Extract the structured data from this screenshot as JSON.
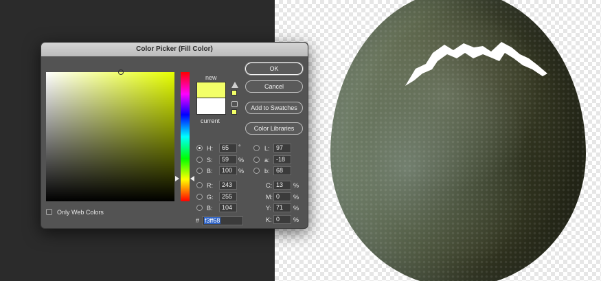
{
  "dialog": {
    "title": "Color Picker (Fill Color)",
    "new_label": "new",
    "current_label": "current",
    "new_color": "#f3ff68",
    "current_color": "#ffffff",
    "buttons": {
      "ok": "OK",
      "cancel": "Cancel",
      "add_to_swatches": "Add to Swatches",
      "color_libraries": "Color Libraries"
    },
    "only_web_colors": "Only Web Colors",
    "hsb": {
      "h": {
        "label": "H:",
        "value": "65",
        "unit": "°"
      },
      "s": {
        "label": "S:",
        "value": "59",
        "unit": "%"
      },
      "b": {
        "label": "B:",
        "value": "100",
        "unit": "%"
      }
    },
    "rgb": {
      "r": {
        "label": "R:",
        "value": "243"
      },
      "g": {
        "label": "G:",
        "value": "255"
      },
      "b": {
        "label": "B:",
        "value": "104"
      }
    },
    "lab": {
      "l": {
        "label": "L:",
        "value": "97"
      },
      "a": {
        "label": "a:",
        "value": "-18"
      },
      "b": {
        "label": "b:",
        "value": "68"
      }
    },
    "cmyk": {
      "c": {
        "label": "C:",
        "value": "13",
        "unit": "%"
      },
      "m": {
        "label": "M:",
        "value": "0",
        "unit": "%"
      },
      "y": {
        "label": "Y:",
        "value": "71",
        "unit": "%"
      },
      "k": {
        "label": "K:",
        "value": "0",
        "unit": "%"
      }
    },
    "hex": {
      "label": "#",
      "value": "f3ff68"
    }
  },
  "icons": {
    "gamut_warning": "warning-triangle-icon",
    "web_safe": "cube-icon"
  }
}
